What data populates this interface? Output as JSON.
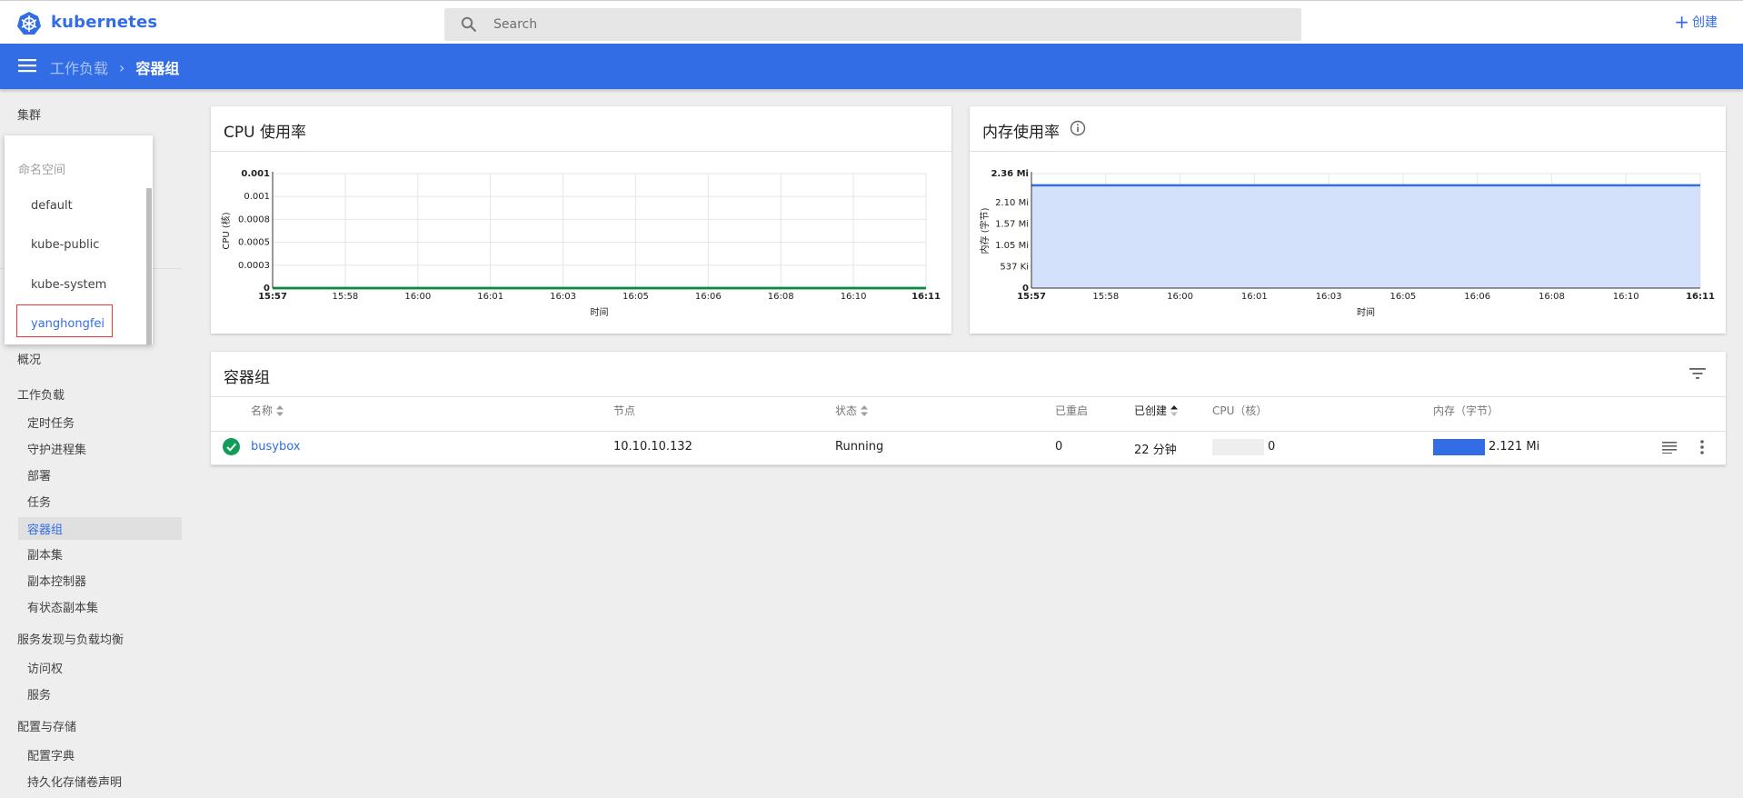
{
  "app": {
    "brand": "kubernetes"
  },
  "search": {
    "placeholder": "Search"
  },
  "header": {
    "create_label": "创建"
  },
  "breadcrumb": {
    "parent": "工作负载",
    "separator": "›",
    "current": "容器组"
  },
  "sidebar": {
    "cluster": "集群",
    "overview": "概况",
    "workloads": {
      "label": "工作负载",
      "items": [
        "定时任务",
        "守护进程集",
        "部署",
        "任务",
        "容器组",
        "副本集",
        "副本控制器",
        "有状态副本集"
      ]
    },
    "discovery": {
      "label": "服务发现与负载均衡",
      "items": [
        "访问权",
        "服务"
      ]
    },
    "config": {
      "label": "配置与存储",
      "items": [
        "配置字典",
        "持久化存储卷声明"
      ]
    }
  },
  "namespace_dropdown": {
    "title": "命名空间",
    "options": [
      "default",
      "kube-public",
      "kube-system",
      "yanghongfei"
    ],
    "selected": "yanghongfei"
  },
  "cpu_card": {
    "title": "CPU 使用率",
    "chart_data": {
      "type": "line",
      "ylabel": "CPU (核)",
      "xlabel": "时间",
      "x": [
        "15:57",
        "15:58",
        "16:00",
        "16:01",
        "16:03",
        "16:05",
        "16:06",
        "16:08",
        "16:10",
        "16:11"
      ],
      "yticks": [
        "0",
        "0.0003",
        "0.0005",
        "0.0008",
        "0.001",
        "0.001"
      ],
      "ylim": [
        0,
        0.0011
      ],
      "series": [
        {
          "values": [
            0,
            0,
            0,
            0,
            0,
            0,
            0,
            0,
            0,
            0
          ],
          "color": "#00c752"
        }
      ],
      "grid": true
    }
  },
  "mem_card": {
    "title": "内存使用率",
    "info_icon": "info-icon",
    "chart_data": {
      "type": "area",
      "ylabel": "内存 (字节)",
      "xlabel": "时间",
      "x": [
        "15:57",
        "15:58",
        "16:00",
        "16:01",
        "16:03",
        "16:05",
        "16:06",
        "16:08",
        "16:10",
        "16:11"
      ],
      "yticks": [
        "0",
        "537 Ki",
        "1.05 Mi",
        "1.57 Mi",
        "2.10 Mi",
        "2.36 Mi"
      ],
      "ylim": [
        0,
        2.36
      ],
      "series": [
        {
          "values": [
            2.12,
            2.12,
            2.12,
            2.12,
            2.12,
            2.12,
            2.12,
            2.12,
            2.12,
            2.12
          ],
          "color": "#326de6"
        }
      ],
      "grid": true
    }
  },
  "pods_card": {
    "title": "容器组",
    "columns": {
      "name": "名称",
      "node": "节点",
      "status": "状态",
      "restarts": "已重启",
      "created": "已创建",
      "cpu": "CPU（核）",
      "memory": "内存（字节）"
    },
    "rows": [
      {
        "name": "busybox",
        "node": "10.10.10.132",
        "status": "Running",
        "restarts": "0",
        "created": "22 分钟",
        "cpu": "0",
        "cpu_fraction": 0,
        "memory": "2.121 Mi",
        "memory_fraction": 1.0
      }
    ]
  },
  "colors": {
    "primary": "#326de6",
    "success": "#0f9d58",
    "cpu_line": "#00c752",
    "mem_fill": "#d4e1fa"
  }
}
